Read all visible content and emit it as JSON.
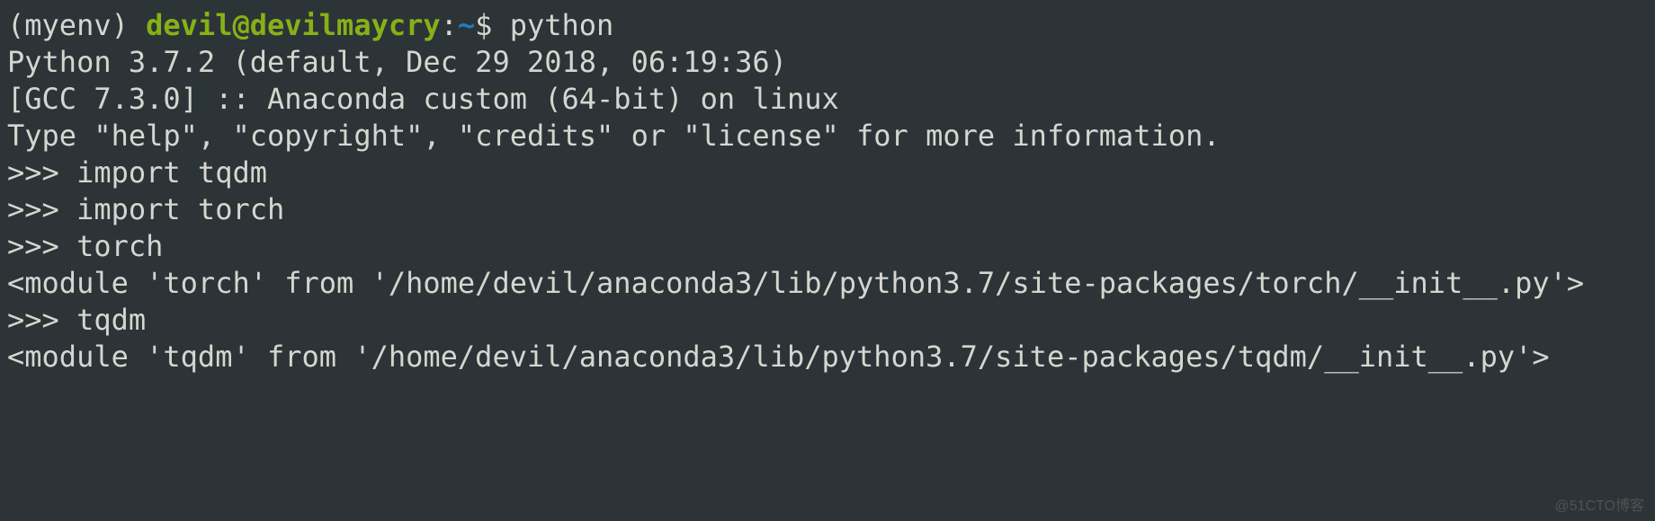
{
  "prompt": {
    "env": "(myenv) ",
    "user_host": "devil@devilmaycry",
    "colon": ":",
    "path": "~",
    "dollar": "$ ",
    "command": "python"
  },
  "python_header": {
    "line1": "Python 3.7.2 (default, Dec 29 2018, 06:19:36)",
    "line2": "[GCC 7.3.0] :: Anaconda custom (64-bit) on linux",
    "line3": "Type \"help\", \"copyright\", \"credits\" or \"license\" for more information."
  },
  "repl": {
    "prompt": ">>> ",
    "entries": [
      {
        "input": "import tqdm",
        "output": null
      },
      {
        "input": "import torch",
        "output": null
      },
      {
        "input": "torch",
        "output": "<module 'torch' from '/home/devil/anaconda3/lib/python3.7/site-packages/torch/__init__.py'>"
      },
      {
        "input": "tqdm",
        "output": "<module 'tqdm' from '/home/devil/anaconda3/lib/python3.7/site-packages/tqdm/__init__.py'>"
      }
    ]
  },
  "watermark": "@51CTO博客"
}
